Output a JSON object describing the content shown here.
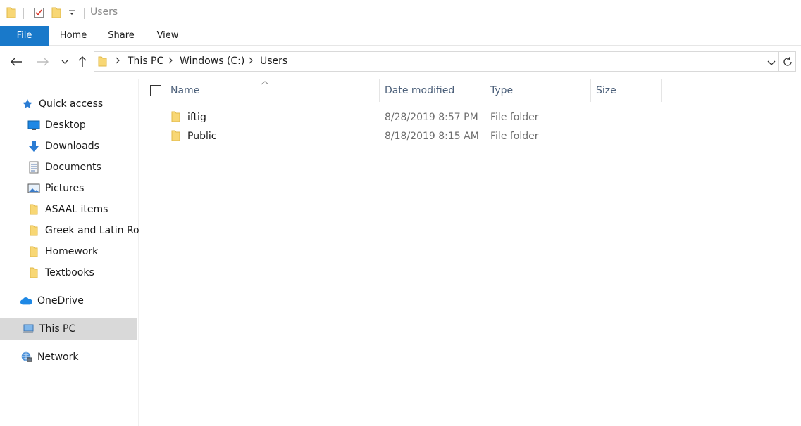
{
  "window": {
    "title": "Users"
  },
  "ribbon": {
    "tabs": [
      {
        "label": "File"
      },
      {
        "label": "Home"
      },
      {
        "label": "Share"
      },
      {
        "label": "View"
      }
    ]
  },
  "address": {
    "crumbs": [
      "This PC",
      "Windows (C:)",
      "Users"
    ]
  },
  "sidebar": {
    "quick_access": "Quick access",
    "items": [
      {
        "label": "Desktop",
        "icon": "desktop-icon",
        "pinned": true
      },
      {
        "label": "Downloads",
        "icon": "download-arrow-icon",
        "pinned": true
      },
      {
        "label": "Documents",
        "icon": "document-icon",
        "pinned": true
      },
      {
        "label": "Pictures",
        "icon": "pictures-icon",
        "pinned": true
      },
      {
        "label": "ASAAL items",
        "icon": "folder-icon",
        "pinned": false
      },
      {
        "label": "Greek and Latin Roo",
        "icon": "folder-icon",
        "pinned": false
      },
      {
        "label": "Homework",
        "icon": "folder-icon",
        "pinned": false
      },
      {
        "label": "Textbooks",
        "icon": "folder-icon",
        "pinned": false
      }
    ],
    "onedrive": "OneDrive",
    "this_pc": "This PC",
    "network": "Network"
  },
  "columns": {
    "name": "Name",
    "date": "Date modified",
    "type": "Type",
    "size": "Size"
  },
  "files": [
    {
      "name": "iftig",
      "date": "8/28/2019 8:57 PM",
      "type": "File folder",
      "size": ""
    },
    {
      "name": "Public",
      "date": "8/18/2019 8:15 AM",
      "type": "File folder",
      "size": ""
    }
  ],
  "colors": {
    "accent": "#1979ca",
    "folder": "#f8d775",
    "selected_bg": "#d9d9d9"
  }
}
